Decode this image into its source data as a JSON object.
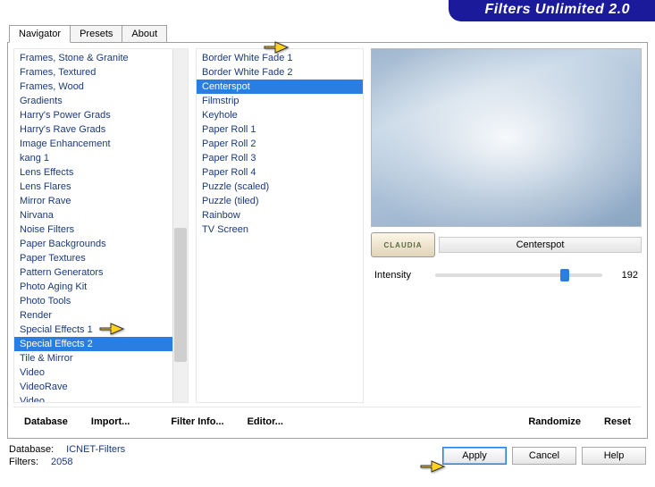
{
  "app": {
    "title": "Filters Unlimited 2.0"
  },
  "tabs": {
    "t0": "Navigator",
    "t1": "Presets",
    "t2": "About"
  },
  "categories": {
    "c0": "Frames, Stone & Granite",
    "c1": "Frames, Textured",
    "c2": "Frames, Wood",
    "c3": "Gradients",
    "c4": "Harry's Power Grads",
    "c5": "Harry's Rave Grads",
    "c6": "Image Enhancement",
    "c7": "kang 1",
    "c8": "Lens Effects",
    "c9": "Lens Flares",
    "c10": "Mirror Rave",
    "c11": "Nirvana",
    "c12": "Noise Filters",
    "c13": "Paper Backgrounds",
    "c14": "Paper Textures",
    "c15": "Pattern Generators",
    "c16": "Photo Aging Kit",
    "c17": "Photo Tools",
    "c18": "Render",
    "c19": "Special Effects 1",
    "c20": "Special Effects 2",
    "c21": "Tile & Mirror",
    "c22": "Video",
    "c23": "VideoRave",
    "c24": "Video"
  },
  "filters": {
    "f0": "Border White Fade 1",
    "f1": "Border White Fade 2",
    "f2": "Centerspot",
    "f3": "Filmstrip",
    "f4": "Keyhole",
    "f5": "Paper Roll 1",
    "f6": "Paper Roll 2",
    "f7": "Paper Roll 3",
    "f8": "Paper Roll 4",
    "f9": "Puzzle (scaled)",
    "f10": "Puzzle (tiled)",
    "f11": "Rainbow",
    "f12": "TV Screen"
  },
  "preview": {
    "watermark": "CLAUDIA",
    "caption": "Centerspot"
  },
  "params": {
    "p0": {
      "label": "Intensity",
      "value": "192",
      "pct": 75
    }
  },
  "buttons": {
    "database": "Database",
    "import": "Import...",
    "filterinfo": "Filter Info...",
    "editor": "Editor...",
    "randomize": "Randomize",
    "reset": "Reset",
    "apply": "Apply",
    "cancel": "Cancel",
    "help": "Help"
  },
  "status": {
    "db_label": "Database:",
    "db_value": "ICNET-Filters",
    "filters_label": "Filters:",
    "filters_value": "2058"
  }
}
